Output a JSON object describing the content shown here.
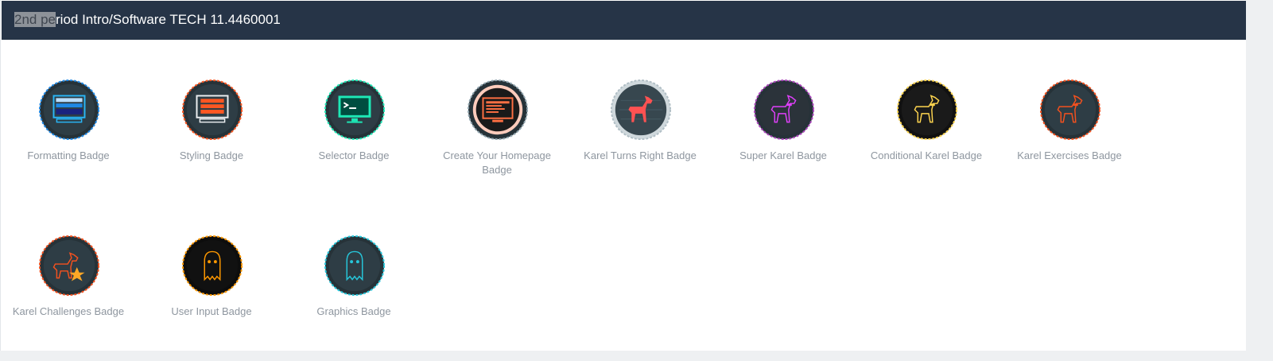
{
  "header": {
    "title_highlight": "2nd pe",
    "title_rest": "riod Intro/Software TECH 11.4460001"
  },
  "badges": [
    {
      "label": "Formatting Badge",
      "icon": "monitor-blue-icon"
    },
    {
      "label": "Styling Badge",
      "icon": "monitor-orange-icon"
    },
    {
      "label": "Selector Badge",
      "icon": "terminal-green-icon"
    },
    {
      "label": "Create Your Homepage Badge",
      "icon": "homepage-monitor-icon"
    },
    {
      "label": "Karel Turns Right Badge",
      "icon": "karel-dog-red-icon"
    },
    {
      "label": "Super Karel Badge",
      "icon": "karel-dog-magenta-icon"
    },
    {
      "label": "Conditional Karel Badge",
      "icon": "karel-dog-yellow-icon"
    },
    {
      "label": "Karel Exercises Badge",
      "icon": "karel-dog-outline-red-icon"
    },
    {
      "label": "Karel Challenges Badge",
      "icon": "karel-dog-star-icon"
    },
    {
      "label": "User Input Badge",
      "icon": "ghost-orange-icon"
    },
    {
      "label": "Graphics Badge",
      "icon": "ghost-teal-icon"
    }
  ],
  "colors": {
    "header_bg": "#263447",
    "badge_dark": "#263238",
    "label": "#8e969f",
    "accent_blue": "#1e88e5",
    "accent_orange": "#ff5722",
    "accent_green": "#1de9b6",
    "accent_red": "#f4511e",
    "accent_magenta": "#e040fb",
    "accent_yellow": "#ffd54f",
    "accent_teal": "#26c6da"
  }
}
